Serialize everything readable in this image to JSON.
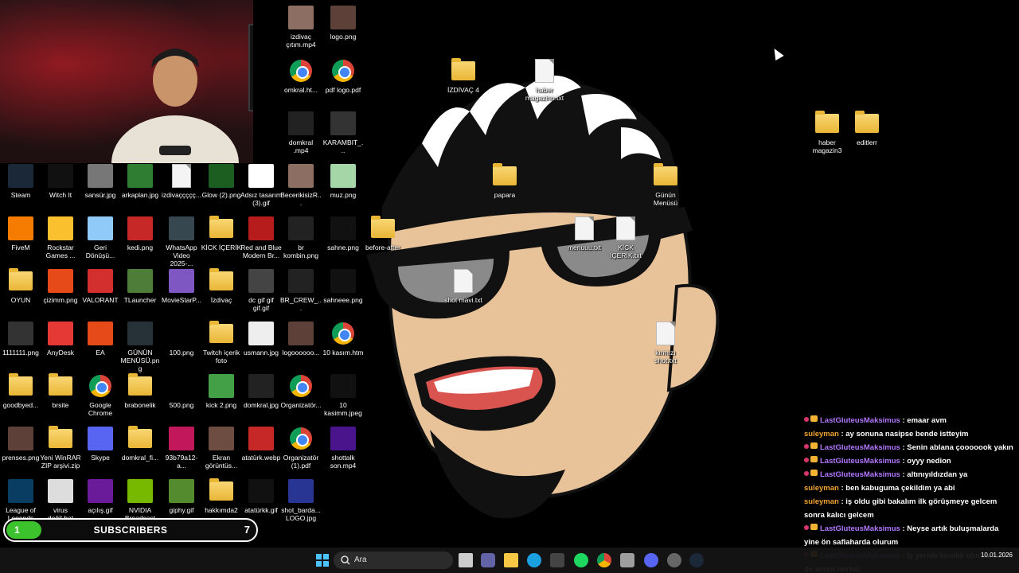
{
  "desktop": {
    "icons": [
      {
        "label": "izdivaç\nçıtım.mp4",
        "type": "thumb",
        "color": "#8d6e63"
      },
      {
        "label": "logo.png",
        "type": "thumb",
        "color": "#5d4037"
      },
      {
        "label": "omkral.ht...",
        "type": "chrome"
      },
      {
        "label": "pdf logo.pdf",
        "type": "chrome"
      },
      {
        "label": "domkral\n.mp4",
        "type": "thumb",
        "color": "#222"
      },
      {
        "label": "KARAMBIT_...",
        "type": "thumb",
        "color": "#333"
      },
      {
        "label": "İZDİVAÇ 4",
        "type": "folder"
      },
      {
        "label": "haber\nmagazinn.txt",
        "type": "doc"
      },
      {
        "label": "haber\nmagazin3",
        "type": "folder"
      },
      {
        "label": "editlerr",
        "type": "folder"
      },
      {
        "label": "Steam",
        "type": "thumb",
        "color": "#1b2838"
      },
      {
        "label": "Witch It",
        "type": "thumb",
        "color": "#111"
      },
      {
        "label": "sansür.jpg",
        "type": "thumb",
        "color": "#777"
      },
      {
        "label": "arkaplan.jpg",
        "type": "thumb",
        "color": "#2e7d32"
      },
      {
        "label": "izdivaççççç...",
        "type": "doc"
      },
      {
        "label": "Glow (2).png",
        "type": "thumb",
        "color": "#1b5e20"
      },
      {
        "label": "Adsız tasarım\n(3).gif",
        "type": "thumb",
        "color": "#fff"
      },
      {
        "label": "BecerikisizR...",
        "type": "thumb",
        "color": "#8d6e63"
      },
      {
        "label": "muz.png",
        "type": "thumb",
        "color": "#a5d6a7"
      },
      {
        "label": "papara",
        "type": "folder"
      },
      {
        "label": "Günün\nMenüsü",
        "type": "folder"
      },
      {
        "label": "FiveM",
        "type": "thumb",
        "color": "#f57c00"
      },
      {
        "label": "Rockstar\nGames ...",
        "type": "thumb",
        "color": "#fbc02d"
      },
      {
        "label": "Geri\nDönüşü...",
        "type": "thumb",
        "color": "#90caf9"
      },
      {
        "label": "kedi.png",
        "type": "thumb",
        "color": "#c62828"
      },
      {
        "label": "WhatsApp\nVideo 2025-...",
        "type": "thumb",
        "color": "#37474f"
      },
      {
        "label": "KİCK İÇERİK",
        "type": "folder"
      },
      {
        "label": "Red and Blue\nModern Br...",
        "type": "thumb",
        "color": "#b71c1c"
      },
      {
        "label": "br\nkombin.png",
        "type": "thumb",
        "color": "#222"
      },
      {
        "label": "sahne.png",
        "type": "thumb",
        "color": "#111"
      },
      {
        "label": "before-after",
        "type": "folder"
      },
      {
        "label": "menuuu.txt",
        "type": "doc"
      },
      {
        "label": "KİCK\nİÇERİK.txt",
        "type": "doc"
      },
      {
        "label": "shot mavi.txt",
        "type": "doc"
      },
      {
        "label": "OYUN",
        "type": "folder"
      },
      {
        "label": "çizimm.png",
        "type": "thumb",
        "color": "#e64a19"
      },
      {
        "label": "VALORANT",
        "type": "thumb",
        "color": "#d32f2f"
      },
      {
        "label": "TLauncher",
        "type": "thumb",
        "color": "#4e7d3a"
      },
      {
        "label": "MovieStarP...",
        "type": "thumb",
        "color": "#7e57c2"
      },
      {
        "label": "İzdivaç",
        "type": "folder"
      },
      {
        "label": "dc gif gif\ngif.gif",
        "type": "thumb",
        "color": "#444"
      },
      {
        "label": "BR_CREW_...",
        "type": "thumb",
        "color": "#222"
      },
      {
        "label": "sahneee.png",
        "type": "thumb",
        "color": "#111"
      },
      {
        "label": "kırmızı\nshot.txt",
        "type": "doc"
      },
      {
        "label": "1111111.png",
        "type": "thumb",
        "color": "#333"
      },
      {
        "label": "AnyDesk",
        "type": "thumb",
        "color": "#e53935"
      },
      {
        "label": "EA",
        "type": "thumb",
        "color": "#e64a19"
      },
      {
        "label": "GÜNÜN\nMENÜSÜ.png",
        "type": "thumb",
        "color": "#263238"
      },
      {
        "label": "100.png",
        "type": "thumb",
        "color": "#000"
      },
      {
        "label": "Twitch içerik\nfoto",
        "type": "folder"
      },
      {
        "label": "usmann.jpg",
        "type": "thumb",
        "color": "#eee"
      },
      {
        "label": "logoooooo...",
        "type": "thumb",
        "color": "#5d4037"
      },
      {
        "label": "10 kasım.htm",
        "type": "chrome"
      },
      {
        "label": "goodbyed...",
        "type": "folder"
      },
      {
        "label": "brsite",
        "type": "folder"
      },
      {
        "label": "Google\nChrome",
        "type": "chrome"
      },
      {
        "label": "brabonelik",
        "type": "folder"
      },
      {
        "label": "500.png",
        "type": "thumb",
        "color": "#000"
      },
      {
        "label": "kick 2.png",
        "type": "thumb",
        "color": "#43a047"
      },
      {
        "label": "domkral.jpg",
        "type": "thumb",
        "color": "#222"
      },
      {
        "label": "Organizatör...",
        "type": "chrome"
      },
      {
        "label": "10\nkasimm.jpeg",
        "type": "thumb",
        "color": "#111"
      },
      {
        "label": "prenses.png",
        "type": "thumb",
        "color": "#5d4037"
      },
      {
        "label": "Yeni WinRAR\nZIP arşivi.zip",
        "type": "folder"
      },
      {
        "label": "Skype",
        "type": "thumb",
        "color": "#5865f2"
      },
      {
        "label": "domkral_fi...",
        "type": "folder"
      },
      {
        "label": "93b79a12-a...",
        "type": "thumb",
        "color": "#c2185b"
      },
      {
        "label": "Ekran\ngörüntüs...",
        "type": "thumb",
        "color": "#6d4c41"
      },
      {
        "label": "atatürk.webp",
        "type": "thumb",
        "color": "#c62828"
      },
      {
        "label": "Organizatör\n(1).pdf",
        "type": "chrome"
      },
      {
        "label": "shottalk\nson.mp4",
        "type": "thumb",
        "color": "#4a148c"
      },
      {
        "label": "League of\nLegends",
        "type": "thumb",
        "color": "#0a3d62"
      },
      {
        "label": "virus\ndeğil.bat",
        "type": "thumb",
        "color": "#ddd"
      },
      {
        "label": "açılış.gif",
        "type": "thumb",
        "color": "#6a1b9a"
      },
      {
        "label": "NVIDIA\nBroadcast",
        "type": "thumb",
        "color": "#76b900"
      },
      {
        "label": "giphy.gif",
        "type": "thumb",
        "color": "#558b2f"
      },
      {
        "label": "hakkımda2",
        "type": "folder"
      },
      {
        "label": "atatürkk.gif",
        "type": "thumb",
        "color": "#111"
      },
      {
        "label": "shot_barda...\nLOGO.jpg",
        "type": "thumb",
        "color": "#283593"
      }
    ]
  },
  "subscribers": {
    "label": "SUBSCRIBERS",
    "current": "1",
    "goal": "7",
    "progress": 0.14,
    "color": "#3cc22c"
  },
  "chat": {
    "messages": [
      {
        "user": "LastGluteusMaksimus",
        "color": "purple",
        "badges": true,
        "text": ": emaar avm"
      },
      {
        "user": "suleyman",
        "color": "orange",
        "badges": false,
        "text": ": ay sonuna nasipse bende istteyim"
      },
      {
        "user": "LastGluteusMaksimus",
        "color": "purple",
        "badges": true,
        "text": ": Senin ablana çooooook yakın"
      },
      {
        "user": "LastGluteusMaksimus",
        "color": "purple",
        "badges": true,
        "text": ": oyyy nedion"
      },
      {
        "user": "LastGluteusMaksimus",
        "color": "purple",
        "badges": true,
        "text": ": altınıyıldızdan ya"
      },
      {
        "user": "suleyman",
        "color": "orange",
        "badges": false,
        "text": ": ben kabuguma çekildim ya abi"
      },
      {
        "user": "suleyman",
        "color": "orange",
        "badges": false,
        "text": ": iş oldu gibi bakalım ilk görüşmeye gelcem sonra kalıcı gelcem"
      },
      {
        "user": "LastGluteusMaksimus",
        "color": "purple",
        "badges": true,
        "text": ": Neyse artık buluşmalarda yine ön saflaharda olurum"
      },
      {
        "user": "LastGluteusMaksimus",
        "color": "purple",
        "badges": true,
        "text": ": İş yeride tanıdık olunca izin de alırım herhal"
      }
    ]
  },
  "taskbar": {
    "search_label": "Ara",
    "time": "10.01.2026"
  }
}
